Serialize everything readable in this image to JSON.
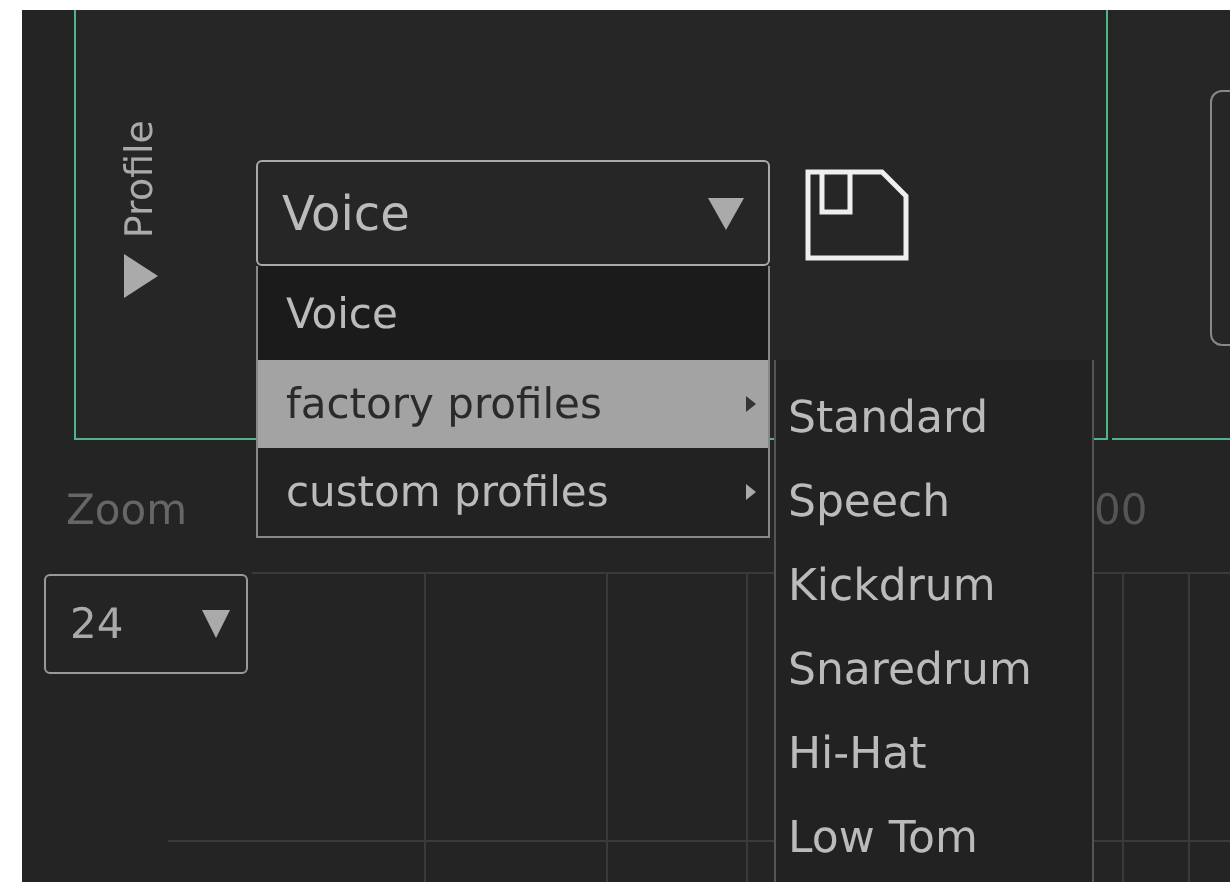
{
  "profile_panel": {
    "title": "Profile",
    "expanded": false,
    "dropdown": {
      "value": "Voice",
      "open": true
    },
    "menu": [
      {
        "label": "Voice",
        "kind": "item",
        "selected": false
      },
      {
        "label": "factory profiles",
        "kind": "submenu",
        "selected": true
      },
      {
        "label": "custom profiles",
        "kind": "submenu",
        "selected": false
      }
    ],
    "submenu": [
      {
        "label": "Standard"
      },
      {
        "label": "Speech"
      },
      {
        "label": "Kickdrum"
      },
      {
        "label": "Snaredrum"
      },
      {
        "label": "Hi-Hat"
      },
      {
        "label": "Low Tom"
      }
    ]
  },
  "zoom": {
    "label": "Zoom",
    "value": "24"
  },
  "axis_labels": [
    "00"
  ]
}
